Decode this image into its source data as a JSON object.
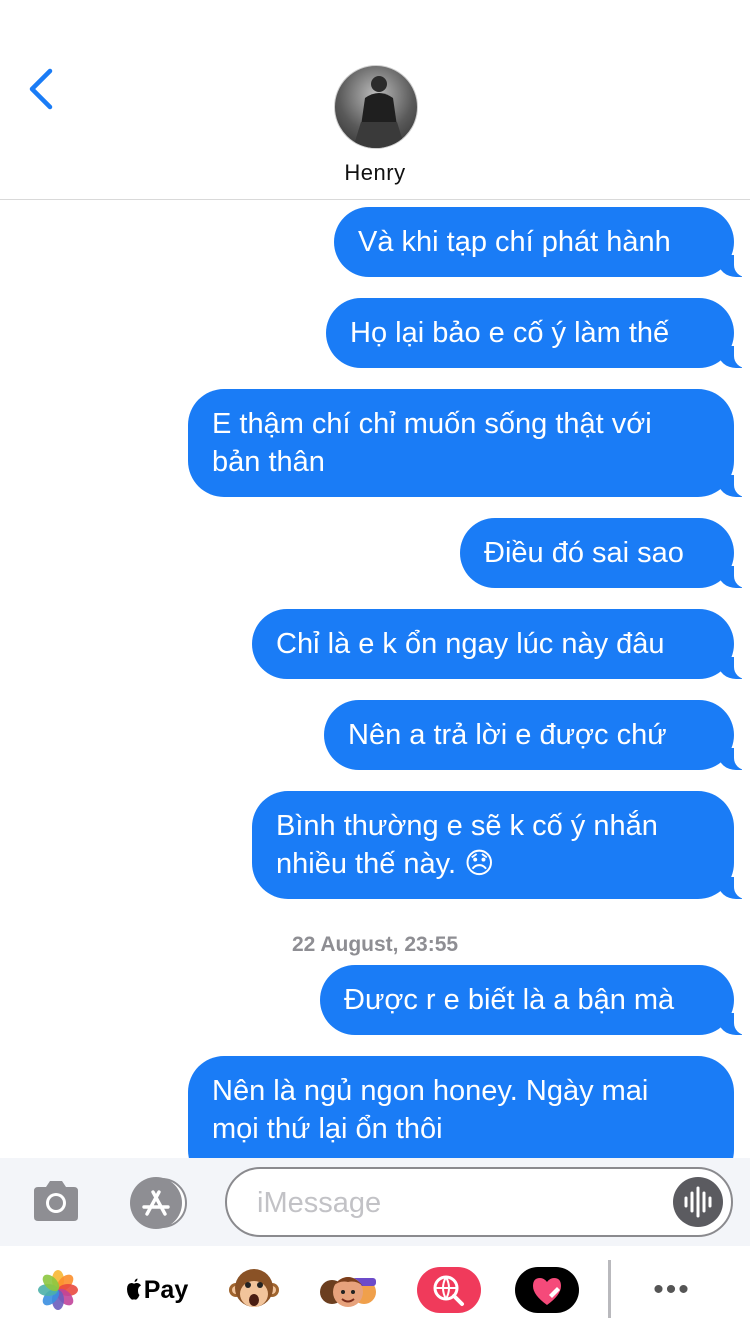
{
  "header": {
    "contact_name": "Henry"
  },
  "messages": [
    {
      "text": "Và khi tạp chí phát hành"
    },
    {
      "text": "Họ lại bảo e cố ý làm thế"
    },
    {
      "text": "E thậm chí chỉ muốn sống thật với\nbản thân"
    },
    {
      "text": "Điều đó sai sao"
    },
    {
      "text": "Chỉ là e k ổn ngay lúc này đâu"
    },
    {
      "text": "Nên a trả lời e được chứ"
    },
    {
      "text": "Bình thường e sẽ k cố ý nhắn\nnhiều thế này. 😞"
    },
    {
      "text": "Được r e biết là a bận mà"
    },
    {
      "text": "Nên là ngủ ngon honey. Ngày mai\nmọi thứ lại ổn thôi"
    }
  ],
  "timestamp": "22 August, 23:55",
  "composer": {
    "placeholder": "iMessage"
  },
  "app_drawer": {
    "apple_pay_label": "Pay",
    "more_label": "•••"
  },
  "colors": {
    "bubble": "#1a7cf6",
    "accent": "#1a7cf6",
    "battery": "#4cd964"
  }
}
